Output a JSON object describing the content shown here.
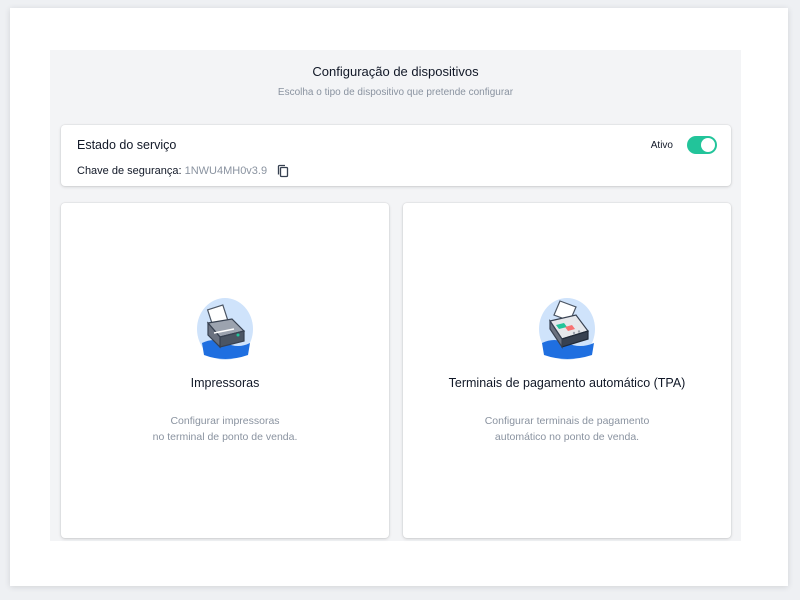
{
  "header": {
    "title": "Configuração de dispositivos",
    "subtitle": "Escolha o tipo de dispositivo que pretende configurar"
  },
  "service": {
    "title": "Estado do serviço",
    "key_label": "Chave de segurança:",
    "key_value": "1NWU4MH0v3.9",
    "status_label": "Ativo",
    "active": true
  },
  "devices": [
    {
      "title": "Impressoras",
      "desc_line1": "Configurar impressoras",
      "desc_line2": "no terminal de ponto de venda.",
      "icon": "printer-icon"
    },
    {
      "title": "Terminais de pagamento automático (TPA)",
      "desc_line1": "Configurar terminais de pagamento",
      "desc_line2": "automático no ponto de venda.",
      "icon": "payment-terminal-icon"
    }
  ],
  "colors": {
    "accent": "#22c49a",
    "muted_text": "#8a93a0",
    "panel_bg": "#f3f4f6",
    "illustration_blue": "#1f6fe0"
  }
}
